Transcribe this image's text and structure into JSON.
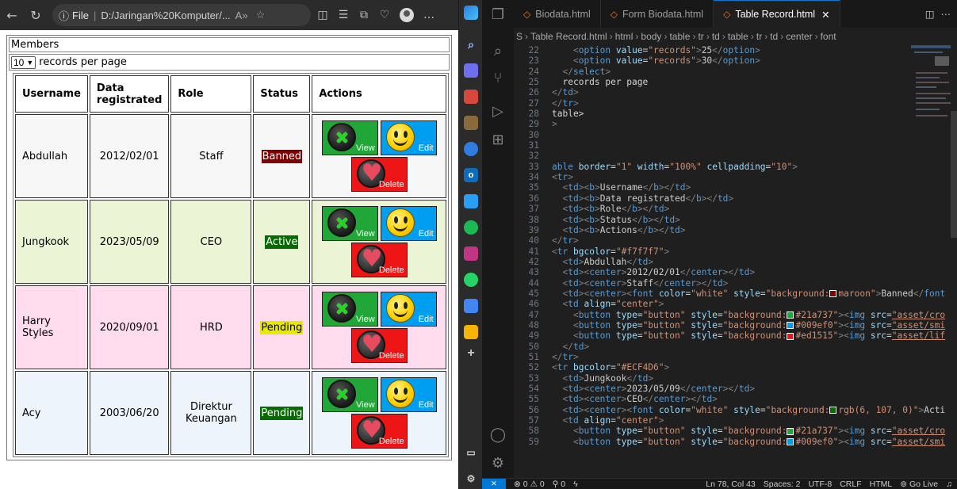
{
  "browser": {
    "address_label": "File",
    "address_url": "D:/Jaringan%20Komputer/...",
    "toolbar_icons": [
      "back-icon",
      "refresh-icon",
      "info-icon",
      "read-aloud-icon",
      "favorite-icon",
      "split-screen-icon",
      "favorites-icon",
      "collections-icon",
      "performance-icon",
      "profile-avatar",
      "more-icon",
      "copilot-icon"
    ]
  },
  "page": {
    "members_label": "Members",
    "records_select": "10",
    "records_suffix": "records per page",
    "headers": [
      "Username",
      "Data registrated",
      "Role",
      "Status",
      "Actions"
    ],
    "rows": [
      {
        "username": "Abdullah",
        "date": "2012/02/01",
        "role": "Staff",
        "status": "Banned",
        "status_color": "#800000",
        "bg": "#f7f7f7"
      },
      {
        "username": "Jungkook",
        "date": "2023/05/09",
        "role": "CEO",
        "status": "Active",
        "status_color": "#066b00",
        "bg": "#ecf4d6"
      },
      {
        "username": "Harry Styles",
        "date": "2020/09/01",
        "role": "HRD",
        "status": "Pending",
        "status_color": "#e8e800",
        "bg": "#ffdcee"
      },
      {
        "username": "Acy",
        "date": "2003/06/20",
        "role": "Direktur Keuangan",
        "status": "Pending",
        "status_color": "#066b00",
        "bg": "#eef4fc"
      }
    ],
    "actions": {
      "view": "View",
      "edit": "Edit",
      "delete": "Delete",
      "view_bg": "#21a737",
      "edit_bg": "#009ef0",
      "delete_bg": "#ed1515"
    }
  },
  "vscode": {
    "tabs": [
      {
        "label": "Biodata.html",
        "active": false
      },
      {
        "label": "Form Biodata.html",
        "active": false
      },
      {
        "label": "Table Record.html",
        "active": true
      }
    ],
    "breadcrumb": [
      "S",
      "Table Record.html",
      "html",
      "body",
      "table",
      "tr",
      "td",
      "table",
      "tr",
      "td",
      "center",
      "font"
    ],
    "status": {
      "errors": "0",
      "warnings": "0",
      "ports": "0",
      "position": "Ln 78, Col 43",
      "spaces": "Spaces: 2",
      "encoding": "UTF-8",
      "eol": "CRLF",
      "language": "HTML",
      "golive": "Go Live"
    },
    "line_numbers": [
      22,
      23,
      24,
      25,
      26,
      27,
      28,
      29,
      30,
      31,
      32,
      33,
      34,
      35,
      36,
      37,
      38,
      39,
      40,
      41,
      42,
      43,
      44,
      45,
      46,
      47,
      48,
      49,
      50,
      51,
      52,
      53,
      54,
      55,
      56,
      57,
      58,
      59
    ]
  }
}
